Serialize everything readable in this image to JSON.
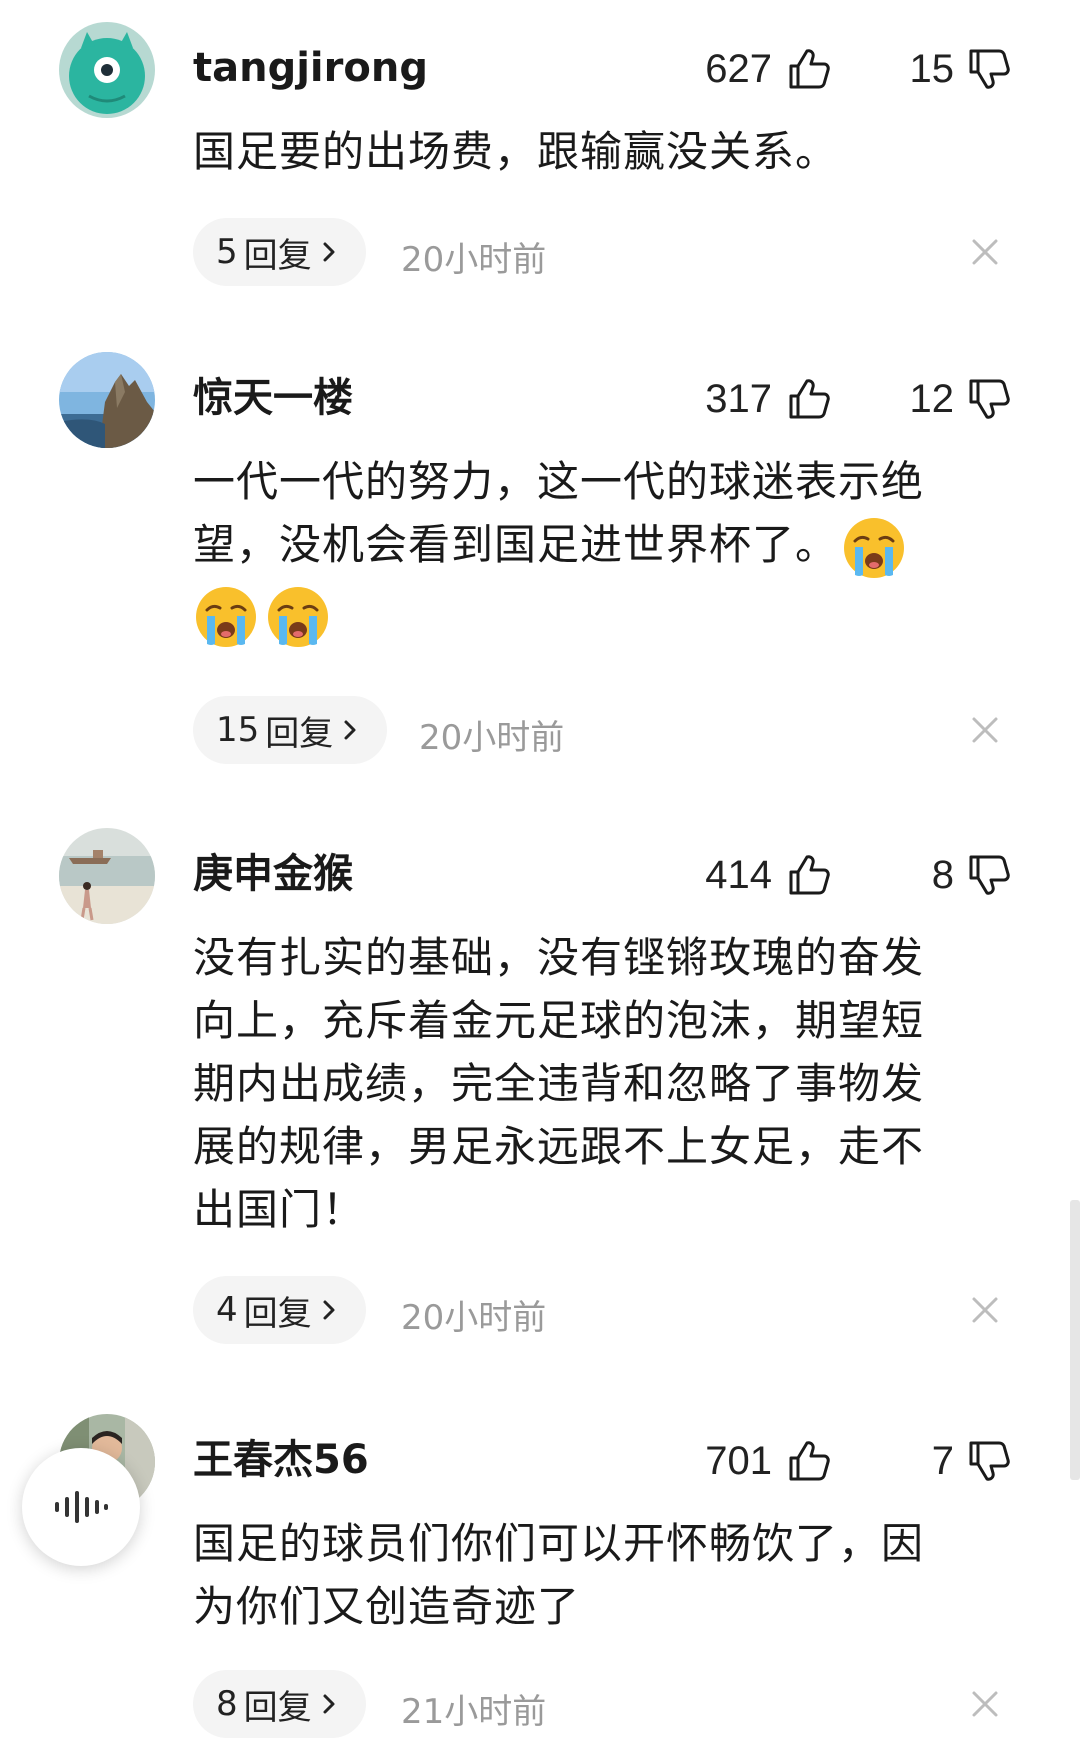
{
  "comments": [
    {
      "username": "tangjirong",
      "likes": "627",
      "dislikes": "15",
      "lines": [
        "国足要的出场费，跟输赢没关系。"
      ],
      "reply_count": "5",
      "reply_label": "回复",
      "time": "20小时前",
      "avatar": "green-monster-avatar"
    },
    {
      "username": "惊天一楼",
      "likes": "317",
      "dislikes": "12",
      "lines": [
        "一代一代的努力，这一代的球迷表示绝",
        "望，没机会看到国足进世界杯了。"
      ],
      "reply_count": "15",
      "reply_label": "回复",
      "time": "20小时前",
      "avatar": "mountain-cliff-avatar",
      "emoji": "loudly-crying-face"
    },
    {
      "username": "庚申金猴",
      "likes": "414",
      "dislikes": "8",
      "lines": [
        "没有扎实的基础，没有铿锵玫瑰的奋发",
        "向上，充斥着金元足球的泡沫，期望短",
        "期内出成绩，完全违背和忽略了事物发",
        "展的规律，男足永远跟不上女足，走不",
        "出国门！"
      ],
      "reply_count": "4",
      "reply_label": "回复",
      "time": "20小时前",
      "avatar": "beach-person-avatar"
    },
    {
      "username": "王春杰56",
      "likes": "701",
      "dislikes": "7",
      "lines": [
        "国足的球员们你们可以开怀畅饮了，因",
        "为你们又创造奇迹了"
      ],
      "reply_count": "8",
      "reply_label": "回复",
      "time": "21小时前",
      "avatar": "man-portrait-avatar"
    }
  ],
  "icons": {
    "like": "thumbs-up-icon",
    "dislike": "thumbs-down-icon",
    "close": "close-icon",
    "chevron": "chevron-right-icon",
    "voice": "voice-wave-icon"
  },
  "colors": {
    "text": "#1a1a1a",
    "meta": "#9a9a9a",
    "pill_bg": "#f4f4f4",
    "avatar_green": "#2bb5a0"
  }
}
